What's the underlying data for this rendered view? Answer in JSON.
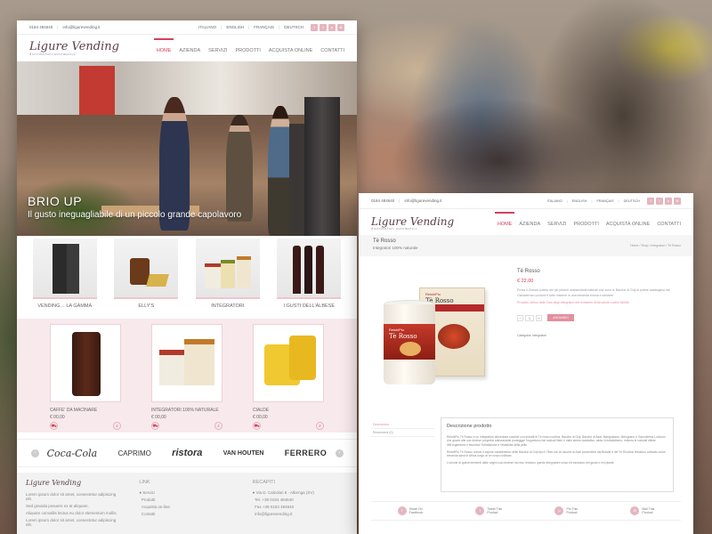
{
  "background_color": "#8b7566",
  "accent_color": "#d4415b",
  "left": {
    "topbar": {
      "phone": "0184 484640",
      "email": "info@ligurevending.it",
      "languages": [
        "ITALIANO",
        "ENGLISH",
        "FRANÇAIS",
        "DEUTSCH"
      ],
      "social_icons": [
        "facebook-icon",
        "twitter-icon",
        "pinterest-icon",
        "instagram-icon"
      ]
    },
    "logo": {
      "text": "Ligure Vending",
      "sub": "distributori automatici"
    },
    "nav": [
      "HOME",
      "AZIENDA",
      "SERVIZI",
      "PRODOTTI",
      "ACQUISTA ONLINE",
      "CONTATTI"
    ],
    "hero": {
      "title": "BRIO UP",
      "subtitle": "Il gusto ineguagliabile di un piccolo grande capolavoro"
    },
    "categories": [
      "VENDING… LA GAMMA",
      "ELLY'S",
      "INTEGRATORI",
      "I GUSTI DELL'ALBESE"
    ],
    "products": [
      {
        "name": "CAFFE' DA MACINARE",
        "price": "€ 00,00"
      },
      {
        "name": "INTEGRATORI 100% NATURALE",
        "price": "€ 00,00"
      },
      {
        "name": "CIALDE",
        "price": "€ 00,00"
      }
    ],
    "brands": [
      "Coca-Cola",
      "CAPRIMO",
      "ristora",
      "VAN HOUTEN",
      "FERRERO"
    ],
    "footer": {
      "col1": [
        "Lorem ipsum dolor sit amet, consectetur adipiscing elit.",
        "Sed gravida posuere ex at aliquam.",
        "Aliquam convallis lectus eu dolor elementum mollis.",
        "Lorem ipsum dolor sit amet, consectetur adipiscing elit."
      ],
      "link_title": "LINK",
      "links": [
        "Servizi",
        "Prodotti",
        "Acquista on-line",
        "Contatti"
      ],
      "recap_title": "RECAPITI",
      "recap": [
        "Via D. Calzolari 8 - Albenga (SV)",
        "Tel. +39 0184 484640",
        "Fax +39 0184 484640",
        "info@ligurevending.it"
      ]
    }
  },
  "right": {
    "topbar": {
      "phone": "0184 484640",
      "email": "info@ligurevending.it",
      "languages": [
        "ITALIANO",
        "ENGLISH",
        "FRANÇAIS",
        "DEUTSCH"
      ]
    },
    "nav": [
      "HOME",
      "AZIENDA",
      "SERVIZI",
      "PRODOTTI",
      "ACQUISTA ONLINE",
      "CONTATTI"
    ],
    "page_title": "Tè Rosso",
    "page_sub": "Integratori 100% naturale",
    "breadcrumb": "Home / Shop / Integratori / Tè Rosso",
    "product": {
      "name": "Tè Rosso",
      "price": "€ 22,00",
      "desc": "Prova il Grande potere dei più potenti antiossidanti naturali che sono le Bacche di Goji al potere adattogeno del Ganoderma Lucidum il tutto insieme in una bevanda buona e salutare.",
      "note": "Prodotto ottimo nelle Dea degli integratori del ministero della salute codice 66066",
      "qty": "1",
      "add_label": "AGGIUNGI",
      "category": "Categoria: Integratori",
      "jar_brand": "ReishiPlu",
      "jar_name": "Tè Rosso"
    },
    "tabs": [
      "Descrizione",
      "Recensioni (0)"
    ],
    "description": {
      "title": "Descrizione prodotto",
      "p1": "ReishiPlu Tè Rosso è un integratore alimentare solubile con estratti di Tè rosso rooibos, Bacche di Goji, Bacche di Asai, Mangostano, Melograno e Ganoderma Lucidum che grazie alle sue diverse proprietà antiossidanti proteggge l'organismo dai radicali liberi e dallo stress ossidativo, aiuta il metabolismo, rinforza le naturali difese dell'organismo e favorisce l'idratazione e l'elasticità della pelle.",
      "p2": "ReishiPlu Tè Rosso unisce il sapore caratteristico delle Bacche di Goji tipo il Tibet con le bacche di Asai provenienti dal Brasile e del Tè Rooibos finissimo coltivato come bevanda sana in Africa lungo ai un corpo coltivato.",
      "p3": "L'unione di questi elementi dalle origini così diverse ha reso rendono questo integratore unico ed esclusivo nel gusto e nei plante."
    },
    "share": [
      {
        "l1": "Share On",
        "l2": "Facebook",
        "icon": "facebook-icon"
      },
      {
        "l1": "Tweet This",
        "l2": "Product",
        "icon": "twitter-icon"
      },
      {
        "l1": "Pin This",
        "l2": "Product",
        "icon": "pinterest-icon"
      },
      {
        "l1": "Mail This",
        "l2": "Product",
        "icon": "mail-icon"
      }
    ]
  }
}
